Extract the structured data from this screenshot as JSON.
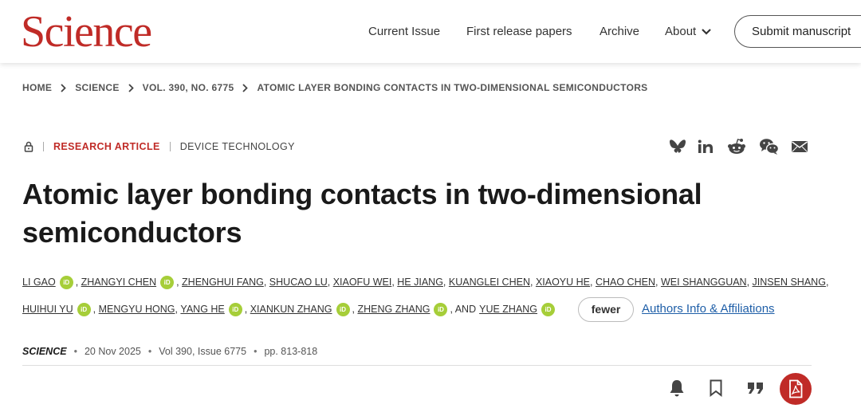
{
  "header": {
    "logo": "Science",
    "nav": [
      "Current Issue",
      "First release papers",
      "Archive",
      "About"
    ],
    "submit_label": "Submit manuscript"
  },
  "breadcrumb": [
    "HOME",
    "SCIENCE",
    "VOL. 390, NO. 6775",
    "ATOMIC LAYER BONDING CONTACTS IN TWO-DIMENSIONAL SEMICONDUCTORS"
  ],
  "article": {
    "type": "RESEARCH ARTICLE",
    "category": "DEVICE TECHNOLOGY",
    "title_line1": "Atomic layer bonding contacts in two-dimensional",
    "title_line2": "semiconductors",
    "orcid_label": "iD",
    "authors_line1": [
      {
        "name": "LI GAO",
        "orcid": true
      },
      {
        "name": "ZHANGYI CHEN",
        "orcid": true
      },
      {
        "name": "ZHENGHUI FANG",
        "orcid": false
      },
      {
        "name": "SHUCAO LU",
        "orcid": false
      },
      {
        "name": "XIAOFU WEI",
        "orcid": false
      },
      {
        "name": "HE JIANG",
        "orcid": false
      },
      {
        "name": "KUANGLEI CHEN",
        "orcid": false
      },
      {
        "name": "XIAOYU HE",
        "orcid": false
      },
      {
        "name": "CHAO CHEN",
        "orcid": false
      },
      {
        "name": "WEI SHANGGUAN",
        "orcid": false
      },
      {
        "name": "JINSEN SHANG",
        "orcid": false
      }
    ],
    "authors_line2": [
      {
        "name": "HUIHUI YU",
        "orcid": true
      },
      {
        "name": "MENGYU HONG",
        "orcid": false
      },
      {
        "name": "YANG HE",
        "orcid": true
      },
      {
        "name": "XIANKUN ZHANG",
        "orcid": true
      },
      {
        "name": "ZHENG ZHANG",
        "orcid": true
      }
    ],
    "and_label": ", AND",
    "last_author": {
      "name": "YUE ZHANG",
      "orcid": true
    },
    "fewer_label": "fewer",
    "affiliations_label": "Authors Info & Affiliations",
    "journal": "SCIENCE",
    "date": "20 Nov 2025",
    "volume": "Vol 390, Issue 6775",
    "pages": "pp. 813-818"
  },
  "icons": {
    "share": [
      "bluesky-icon",
      "linkedin-icon",
      "reddit-icon",
      "wechat-icon",
      "email-icon"
    ],
    "tools": [
      "bell-icon",
      "bookmark-icon",
      "quote-icon",
      "pdf-icon"
    ],
    "lock": "lock-icon"
  },
  "colors": {
    "brand": "#c02b27",
    "orcid": "#a6ce39",
    "link": "#1f5fa8"
  }
}
